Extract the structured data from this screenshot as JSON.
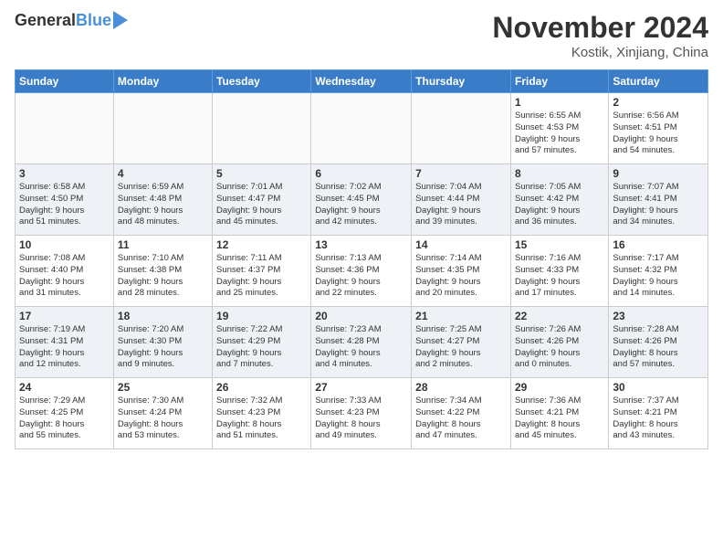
{
  "header": {
    "logo_general": "General",
    "logo_blue": "Blue",
    "month_title": "November 2024",
    "location": "Kostik, Xinjiang, China"
  },
  "weekdays": [
    "Sunday",
    "Monday",
    "Tuesday",
    "Wednesday",
    "Thursday",
    "Friday",
    "Saturday"
  ],
  "weeks": [
    [
      {
        "day": "",
        "info": ""
      },
      {
        "day": "",
        "info": ""
      },
      {
        "day": "",
        "info": ""
      },
      {
        "day": "",
        "info": ""
      },
      {
        "day": "",
        "info": ""
      },
      {
        "day": "1",
        "info": "Sunrise: 6:55 AM\nSunset: 4:53 PM\nDaylight: 9 hours\nand 57 minutes."
      },
      {
        "day": "2",
        "info": "Sunrise: 6:56 AM\nSunset: 4:51 PM\nDaylight: 9 hours\nand 54 minutes."
      }
    ],
    [
      {
        "day": "3",
        "info": "Sunrise: 6:58 AM\nSunset: 4:50 PM\nDaylight: 9 hours\nand 51 minutes."
      },
      {
        "day": "4",
        "info": "Sunrise: 6:59 AM\nSunset: 4:48 PM\nDaylight: 9 hours\nand 48 minutes."
      },
      {
        "day": "5",
        "info": "Sunrise: 7:01 AM\nSunset: 4:47 PM\nDaylight: 9 hours\nand 45 minutes."
      },
      {
        "day": "6",
        "info": "Sunrise: 7:02 AM\nSunset: 4:45 PM\nDaylight: 9 hours\nand 42 minutes."
      },
      {
        "day": "7",
        "info": "Sunrise: 7:04 AM\nSunset: 4:44 PM\nDaylight: 9 hours\nand 39 minutes."
      },
      {
        "day": "8",
        "info": "Sunrise: 7:05 AM\nSunset: 4:42 PM\nDaylight: 9 hours\nand 36 minutes."
      },
      {
        "day": "9",
        "info": "Sunrise: 7:07 AM\nSunset: 4:41 PM\nDaylight: 9 hours\nand 34 minutes."
      }
    ],
    [
      {
        "day": "10",
        "info": "Sunrise: 7:08 AM\nSunset: 4:40 PM\nDaylight: 9 hours\nand 31 minutes."
      },
      {
        "day": "11",
        "info": "Sunrise: 7:10 AM\nSunset: 4:38 PM\nDaylight: 9 hours\nand 28 minutes."
      },
      {
        "day": "12",
        "info": "Sunrise: 7:11 AM\nSunset: 4:37 PM\nDaylight: 9 hours\nand 25 minutes."
      },
      {
        "day": "13",
        "info": "Sunrise: 7:13 AM\nSunset: 4:36 PM\nDaylight: 9 hours\nand 22 minutes."
      },
      {
        "day": "14",
        "info": "Sunrise: 7:14 AM\nSunset: 4:35 PM\nDaylight: 9 hours\nand 20 minutes."
      },
      {
        "day": "15",
        "info": "Sunrise: 7:16 AM\nSunset: 4:33 PM\nDaylight: 9 hours\nand 17 minutes."
      },
      {
        "day": "16",
        "info": "Sunrise: 7:17 AM\nSunset: 4:32 PM\nDaylight: 9 hours\nand 14 minutes."
      }
    ],
    [
      {
        "day": "17",
        "info": "Sunrise: 7:19 AM\nSunset: 4:31 PM\nDaylight: 9 hours\nand 12 minutes."
      },
      {
        "day": "18",
        "info": "Sunrise: 7:20 AM\nSunset: 4:30 PM\nDaylight: 9 hours\nand 9 minutes."
      },
      {
        "day": "19",
        "info": "Sunrise: 7:22 AM\nSunset: 4:29 PM\nDaylight: 9 hours\nand 7 minutes."
      },
      {
        "day": "20",
        "info": "Sunrise: 7:23 AM\nSunset: 4:28 PM\nDaylight: 9 hours\nand 4 minutes."
      },
      {
        "day": "21",
        "info": "Sunrise: 7:25 AM\nSunset: 4:27 PM\nDaylight: 9 hours\nand 2 minutes."
      },
      {
        "day": "22",
        "info": "Sunrise: 7:26 AM\nSunset: 4:26 PM\nDaylight: 9 hours\nand 0 minutes."
      },
      {
        "day": "23",
        "info": "Sunrise: 7:28 AM\nSunset: 4:26 PM\nDaylight: 8 hours\nand 57 minutes."
      }
    ],
    [
      {
        "day": "24",
        "info": "Sunrise: 7:29 AM\nSunset: 4:25 PM\nDaylight: 8 hours\nand 55 minutes."
      },
      {
        "day": "25",
        "info": "Sunrise: 7:30 AM\nSunset: 4:24 PM\nDaylight: 8 hours\nand 53 minutes."
      },
      {
        "day": "26",
        "info": "Sunrise: 7:32 AM\nSunset: 4:23 PM\nDaylight: 8 hours\nand 51 minutes."
      },
      {
        "day": "27",
        "info": "Sunrise: 7:33 AM\nSunset: 4:23 PM\nDaylight: 8 hours\nand 49 minutes."
      },
      {
        "day": "28",
        "info": "Sunrise: 7:34 AM\nSunset: 4:22 PM\nDaylight: 8 hours\nand 47 minutes."
      },
      {
        "day": "29",
        "info": "Sunrise: 7:36 AM\nSunset: 4:21 PM\nDaylight: 8 hours\nand 45 minutes."
      },
      {
        "day": "30",
        "info": "Sunrise: 7:37 AM\nSunset: 4:21 PM\nDaylight: 8 hours\nand 43 minutes."
      }
    ]
  ]
}
